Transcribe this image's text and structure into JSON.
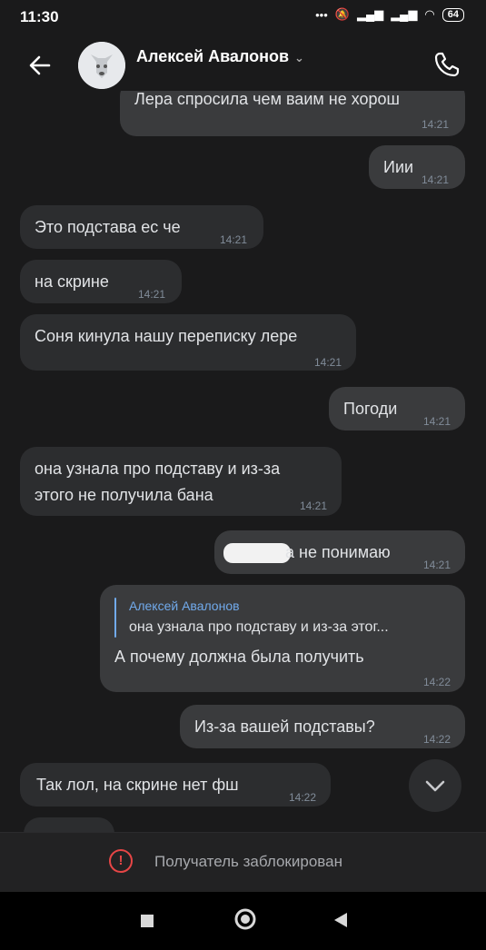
{
  "status": {
    "time": "11:30",
    "battery": "64"
  },
  "header": {
    "contact_name": "Алексей Авалонов"
  },
  "messages": [
    {
      "text": "Лера спросила чем ваим не хорош",
      "time": "14:21"
    },
    {
      "text": "Иии",
      "time": "14:21"
    },
    {
      "text": "Это подстава ес че",
      "time": "14:21"
    },
    {
      "text": "на скрине",
      "time": "14:21"
    },
    {
      "text": "Соня кинула нашу переписку лере",
      "time": "14:21"
    },
    {
      "text": "Погоди",
      "time": "14:21"
    },
    {
      "line1": "она узнала про подставу и из-за",
      "line2": "этого не получила бана",
      "time": "14:21"
    },
    {
      "text": "а не понимаю",
      "time": "14:21"
    },
    {
      "reply_author": "Алексей Авалонов",
      "reply_text": "она узнала про подставу и из-за этог...",
      "text": "А почему должна была получить",
      "time": "14:22"
    },
    {
      "text": "Из-за вашей подставы?",
      "time": "14:22"
    },
    {
      "text": "Так лол, на скрине нет фш",
      "time": "14:22"
    }
  ],
  "footer": {
    "blocked_text": "Получатель заблокирован"
  },
  "colors": {
    "accent": "#71aaeb",
    "danger": "#e64646",
    "bubble": "#2c2d2f",
    "background": "#1a1a1b"
  },
  "icons": [
    "back-arrow-icon",
    "phone-icon",
    "chevron-down-icon",
    "alert-icon",
    "square-icon",
    "circle-icon",
    "triangle-back-icon"
  ]
}
